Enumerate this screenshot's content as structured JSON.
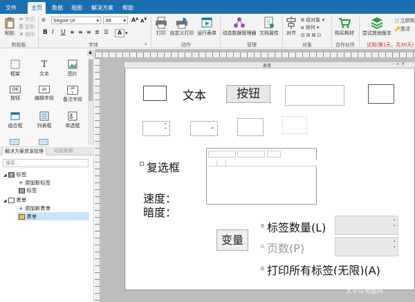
{
  "menu": {
    "file": "文件",
    "home": "主页",
    "data": "数据",
    "view": "视图",
    "solution": "解决方案",
    "help": "帮助"
  },
  "ribbon": {
    "clipboard": {
      "paste": "粘贴",
      "cut": "剪切",
      "copy": "复制",
      "delete": "删除",
      "label": "剪贴板"
    },
    "font": {
      "family": "Segoe UI",
      "size": "36",
      "label": "字体"
    },
    "action": {
      "print": "打印",
      "custom_print": "自定义打印",
      "run_form": "运行表单",
      "label": "动作"
    },
    "manage": {
      "dynamic_data": "动态数据管理器",
      "doc_props": "文档属性",
      "label": "管理"
    },
    "object": {
      "align": "对齐",
      "group": "组对象",
      "arrange": "排列",
      "label": "对象"
    },
    "partner": {
      "buy": "购买耗材",
      "label": "合作伙伴"
    },
    "other": {
      "try_other": "尝试其他版本",
      "buy_now": "立即购",
      "activate": "激活",
      "trial": "试用(第1天，共30天)"
    }
  },
  "toolbox": {
    "items": [
      "框架",
      "文本",
      "图片",
      "按钮",
      "编辑字段",
      "备注字段",
      "组合框",
      "列表框",
      "单选框"
    ]
  },
  "panel_tabs": {
    "resources": "解决方案资源管理",
    "dynamic": "动态数据"
  },
  "tree": {
    "search_placeholder": "搜索...",
    "labels": "标签",
    "add_label": "添加新标签",
    "label_item": "标签",
    "forms": "表单",
    "add_form": "添加新表单",
    "form_item": "表单"
  },
  "form": {
    "title": "表单",
    "text": "文本",
    "button": "按钮",
    "checkbox": "复选框",
    "speed": "速度：",
    "darkness": "暗度：",
    "variable": "变量",
    "label_count": "标签数量(L)",
    "pages": "页数(P)",
    "print_all": "打印所有标签(无限)(A)"
  },
  "watermark": "PCONLINE",
  "watermark_sub": "太平洋电脑网"
}
